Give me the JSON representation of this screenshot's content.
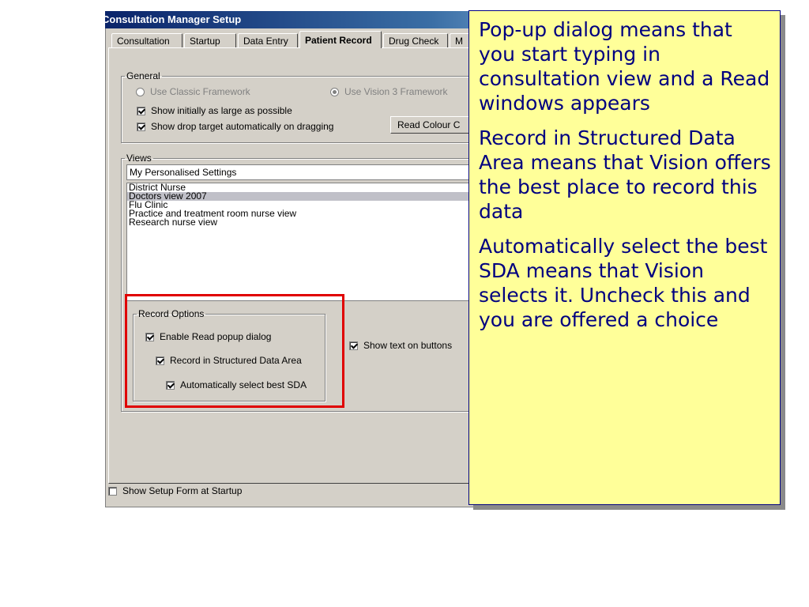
{
  "window": {
    "title": "Consultation Manager Setup"
  },
  "tabs": [
    {
      "label": "Consultation"
    },
    {
      "label": "Startup"
    },
    {
      "label": "Data Entry"
    },
    {
      "label": "Patient Record"
    },
    {
      "label": "Drug Check"
    },
    {
      "label": "M"
    }
  ],
  "general": {
    "legend": "General",
    "classic_framework": "Use Classic Framework",
    "vision3_framework": "Use Vision 3 Framework",
    "show_large": "Show initially as large as possible",
    "show_drop_target": "Show drop target automatically on dragging",
    "read_colour_button": "Read Colour C"
  },
  "views": {
    "legend": "Views",
    "current": "My Personalised Settings",
    "items": [
      "District Nurse",
      "Doctors view 2007",
      "Flu Clinic",
      "Practice and treatment room nurse view",
      "Research nurse view"
    ],
    "selected_index": 1
  },
  "record_options": {
    "legend": "Record Options",
    "enable_popup": "Enable Read popup dialog",
    "record_sda": "Record in Structured Data Area",
    "auto_select_sda": "Automatically select best SDA"
  },
  "show_text_on_buttons": "Show text on buttons",
  "show_setup_form": "Show Setup Form at Startup",
  "callout": {
    "para1": "Pop-up dialog means that you start typing in consultation view and a Read windows appears",
    "para2": "Record in Structured Data Area means that Vision offers the best place to record this data",
    "para3": "Automatically select the best SDA means that Vision selects it. Uncheck this and you are offered a choice"
  },
  "colors": {
    "highlight_border": "#e00000",
    "callout_bg": "#ffff99",
    "callout_text": "#000080"
  }
}
